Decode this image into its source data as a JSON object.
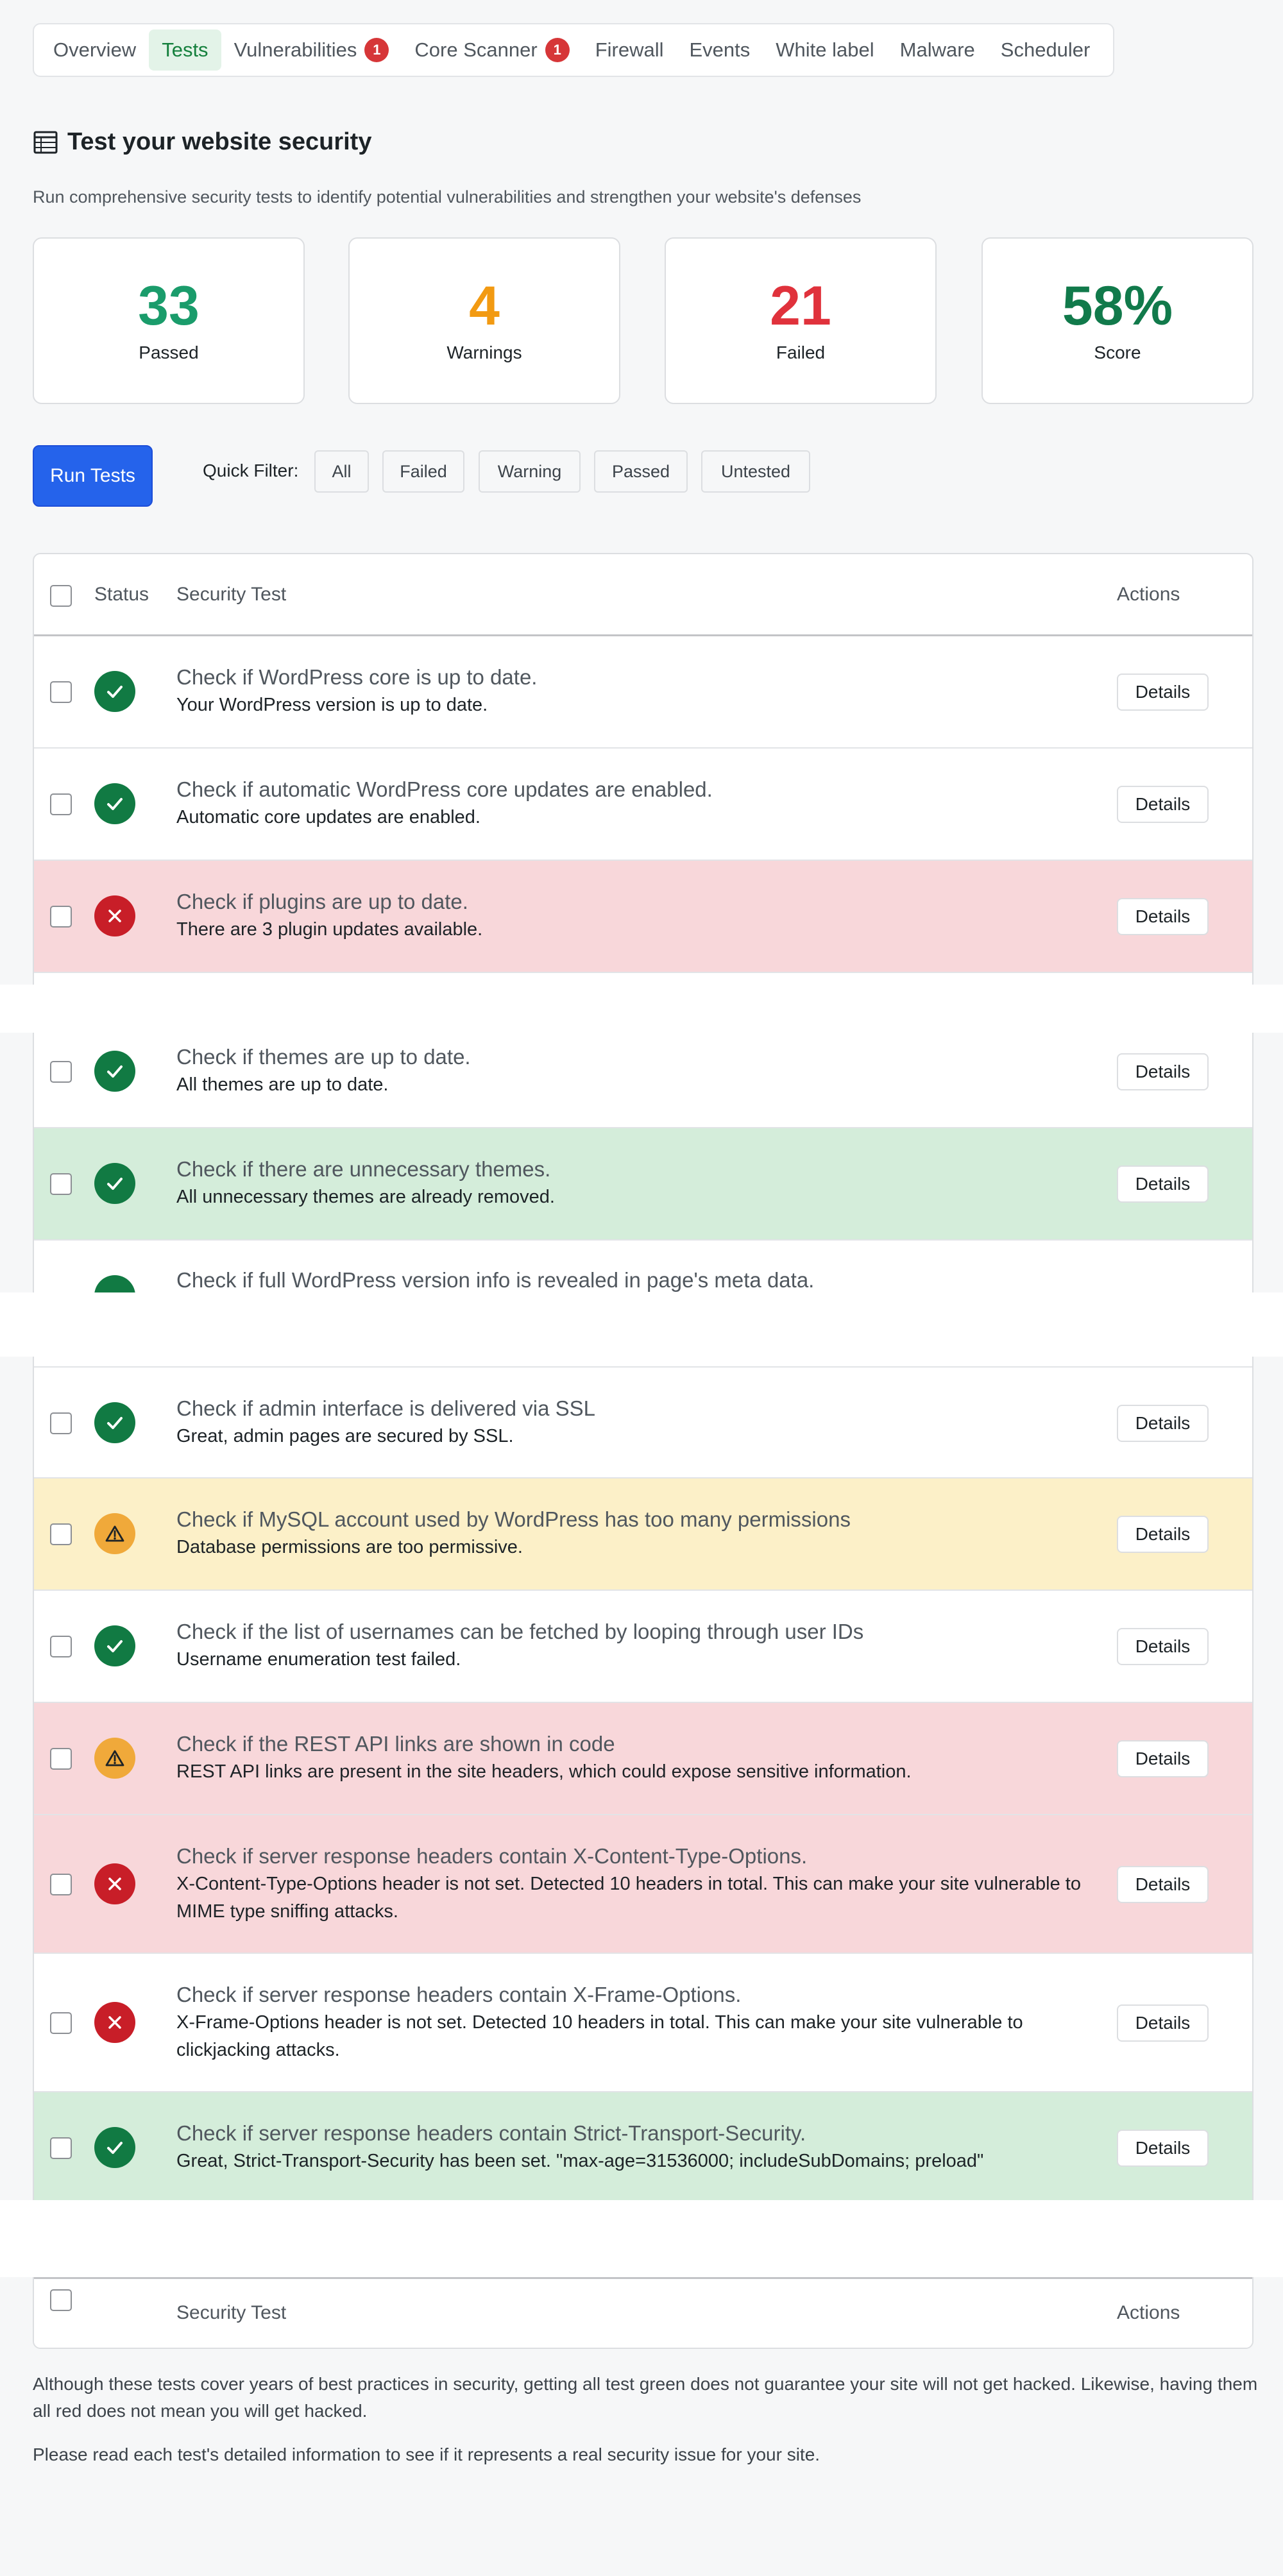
{
  "tabs": [
    {
      "label": "Overview"
    },
    {
      "label": "Tests",
      "active": true
    },
    {
      "label": "Vulnerabilities",
      "badge": "1"
    },
    {
      "label": "Core Scanner",
      "badge": "1"
    },
    {
      "label": "Firewall"
    },
    {
      "label": "Events"
    },
    {
      "label": "White label"
    },
    {
      "label": "Malware"
    },
    {
      "label": "Scheduler"
    }
  ],
  "header": {
    "title": "Test your website security",
    "subtitle": "Run comprehensive security tests to identify potential vulnerabilities and strengthen your website's defenses"
  },
  "stats": [
    {
      "value": "33",
      "label": "Passed",
      "color": "#1a9c6b"
    },
    {
      "value": "4",
      "label": "Warnings",
      "color": "#f29a12"
    },
    {
      "value": "21",
      "label": "Failed",
      "color": "#e0323c"
    },
    {
      "value": "58%",
      "label": "Score",
      "color": "#117a4b"
    }
  ],
  "controls": {
    "run_label": "Run Tests",
    "quick_filter_label": "Quick Filter:",
    "filters": [
      "All",
      "Failed",
      "Warning",
      "Passed",
      "Untested"
    ]
  },
  "table": {
    "columns": {
      "status": "Status",
      "test": "Security Test",
      "actions": "Actions"
    },
    "details_label": "Details",
    "rows": [
      {
        "status": "pass",
        "title": "Check if WordPress core is up to date.",
        "desc": "Your WordPress version is up to date."
      },
      {
        "status": "pass",
        "title": "Check if automatic WordPress core updates are enabled.",
        "desc": "Automatic core updates are enabled."
      },
      {
        "status": "fail",
        "title": "Check if plugins are up to date.",
        "desc": "There are 3 plugin updates available."
      },
      {
        "status": "pass",
        "title": "Check if themes are up to date.",
        "desc": "All themes are up to date."
      },
      {
        "status": "pass",
        "title": "Check if there are unnecessary themes.",
        "desc": "All unnecessary themes are already removed."
      },
      {
        "status": "pass",
        "title": "Check if full WordPress version info is revealed in page's meta data.",
        "desc": ""
      },
      {
        "status": "pass",
        "title": "Check if admin interface is delivered via SSL",
        "desc": "Great, admin pages are secured by SSL."
      },
      {
        "status": "warn",
        "title": "Check if MySQL account used by WordPress has too many permissions",
        "desc": "Database permissions are too permissive."
      },
      {
        "status": "pass",
        "title": "Check if the list of usernames can be fetched by looping through user IDs",
        "desc": "Username enumeration test failed."
      },
      {
        "status": "warn",
        "title": "Check if the REST API links are shown in code",
        "desc": "REST API links are present in the site headers, which could expose sensitive information."
      },
      {
        "status": "fail",
        "title": "Check if server response headers contain X-Content-Type-Options.",
        "desc": "X-Content-Type-Options header is not set. Detected 10 headers in total. This can make your site vulnerable to MIME type sniffing attacks."
      },
      {
        "status": "fail",
        "title": "Check if server response headers contain X-Frame-Options.",
        "desc": "X-Frame-Options header is not set. Detected 10 headers in total. This can make your site vulnerable to clickjacking attacks."
      },
      {
        "status": "pass",
        "title": "Check if server response headers contain Strict-Transport-Security.",
        "desc": "Great, Strict-Transport-Security has been set. \"max-age=31536000; includeSubDomains; preload\""
      }
    ]
  },
  "footer_notes": [
    "Although these tests cover years of best practices in security, getting all test green does not guarantee your site will not get hacked. Likewise, having them all red does not mean you will get hacked.",
    "Please read each test's detailed information to see if it represents a real security issue for your site."
  ],
  "colors": {
    "pass": "#117a43",
    "fail": "#c81e28",
    "warn": "#f0a93a",
    "primary": "#2563eb"
  },
  "icons": {
    "pass": "checkmark-icon",
    "fail": "x-icon",
    "warn": "warning-triangle-icon",
    "title": "table-icon"
  }
}
